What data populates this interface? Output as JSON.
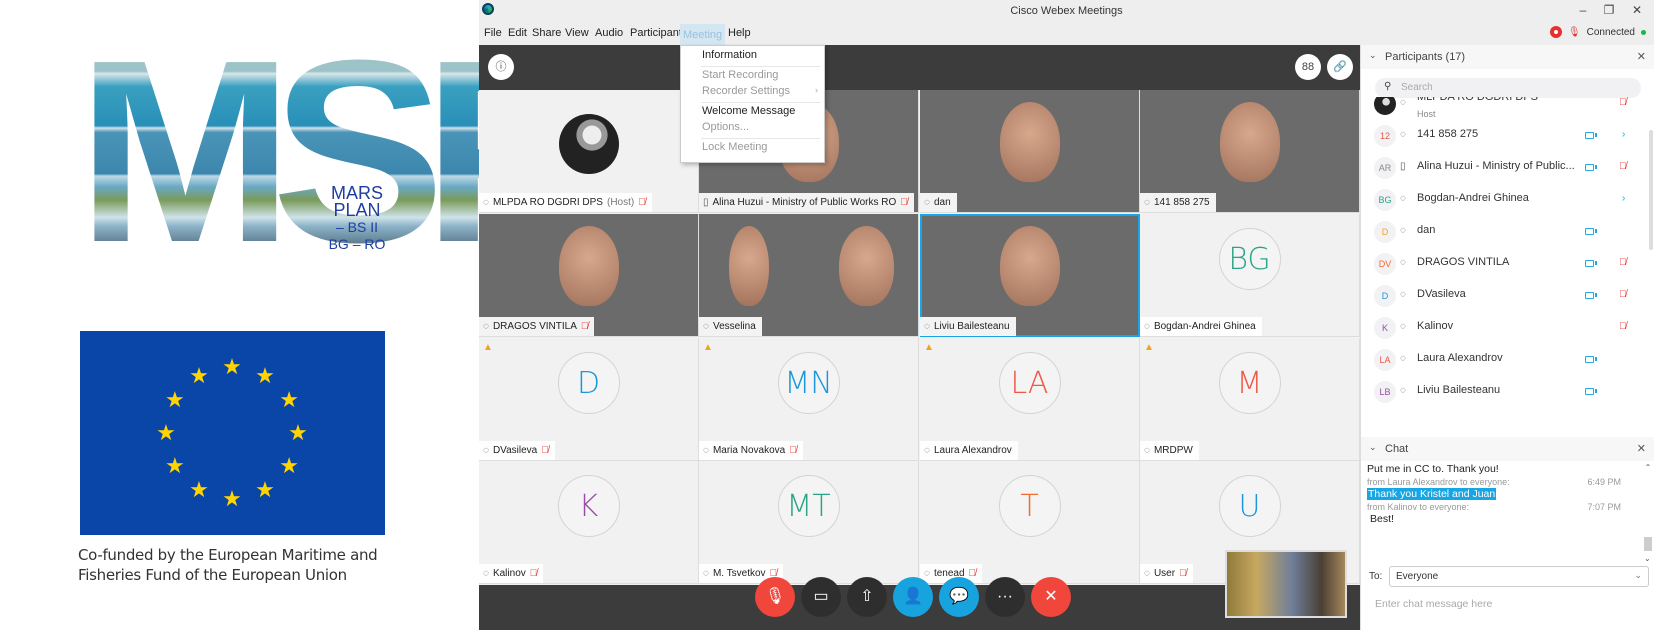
{
  "logos": {
    "msp_letters": "MSP",
    "msp_lines": [
      "MARS",
      "PLAN",
      "– BS II",
      "BG – RO"
    ],
    "eu_caption_lines": [
      "Co-funded by the European Maritime and",
      "Fisheries Fund of the European Union"
    ],
    "eu_colors": {
      "flag": "#0a46a8",
      "star": "#ffd400"
    }
  },
  "window": {
    "title": "Cisco Webex Meetings",
    "controls": {
      "minimize": "–",
      "restore": "❐",
      "close": "✕"
    },
    "menu": [
      "File",
      "Edit",
      "Share",
      "View",
      "Audio",
      "Participant",
      "Meeting",
      "Help"
    ],
    "active_menu": "Meeting",
    "status": {
      "connection": "Connected"
    }
  },
  "meeting_menu": {
    "items": [
      {
        "label": "Information",
        "enabled": true
      },
      {
        "label": "Start Recording",
        "enabled": false
      },
      {
        "label": "Recorder Settings",
        "enabled": false,
        "submenu": true
      },
      {
        "label": "Welcome Message",
        "enabled": true
      },
      {
        "label": "Options...",
        "enabled": false
      },
      {
        "label": "Lock Meeting",
        "enabled": false
      }
    ]
  },
  "header": {
    "info_icon": "ⓘ",
    "layout_icon": "88",
    "link_icon": "🔗"
  },
  "tiles": [
    {
      "name": "MLPDA RO DGDRI DPS",
      "suffix": "(Host)",
      "type": "photo",
      "muted": true,
      "device": "headset"
    },
    {
      "name": "Alina Huzui - Ministry of Public Works RO",
      "type": "video",
      "muted": true,
      "device": "phone"
    },
    {
      "name": "dan",
      "type": "video",
      "muted": false,
      "device": "headset"
    },
    {
      "name": "141 858 275",
      "type": "video",
      "muted": false,
      "device": "headset"
    },
    {
      "name": "DRAGOS VINTILA",
      "type": "video",
      "muted": true,
      "device": "headset"
    },
    {
      "name": "Vesselina",
      "type": "video",
      "muted": false,
      "device": "headset"
    },
    {
      "name": "Liviu Bailesteanu",
      "type": "video",
      "muted": false,
      "active": true,
      "device": "headset"
    },
    {
      "name": "Bogdan-Andrei Ghinea",
      "type": "initials",
      "initials": "BG",
      "color": "#2aa486",
      "muted": false
    },
    {
      "name": "DVasileva",
      "type": "initials",
      "initials": "D",
      "color": "#1b96d8",
      "muted": true,
      "warning": true
    },
    {
      "name": "Maria Novakova",
      "type": "initials",
      "initials": "MN",
      "color": "#1b96d8",
      "muted": true,
      "warning": true
    },
    {
      "name": "Laura Alexandrov",
      "type": "initials",
      "initials": "LA",
      "color": "#ef5646",
      "muted": false,
      "warning": true
    },
    {
      "name": "MRDPW",
      "type": "initials",
      "initials": "M",
      "color": "#ef5646",
      "muted": false,
      "warning": true
    },
    {
      "name": "Kalinov",
      "type": "initials",
      "initials": "K",
      "color": "#9a4aa8",
      "muted": true
    },
    {
      "name": "M. Tsvetkov",
      "type": "initials",
      "initials": "MT",
      "color": "#2aa486",
      "muted": true
    },
    {
      "name": "tenead",
      "type": "initials",
      "initials": "T",
      "color": "#f36b2c",
      "muted": true
    },
    {
      "name": "User",
      "type": "initials",
      "initials": "U",
      "color": "#1b96d8",
      "muted": true
    }
  ],
  "controls": {
    "mute": "🎙",
    "video": "▭",
    "share": "⇧",
    "participants": "👤",
    "chat": "💬",
    "more": "···",
    "leave": "✕"
  },
  "participants_panel": {
    "title": "Participants (17)",
    "search_placeholder": "Search",
    "rows": [
      {
        "initials": "",
        "name": "MLPDA RO DGDRI DPS",
        "sub": "Host",
        "video": false,
        "muted": true,
        "device": "headset"
      },
      {
        "initials": "12",
        "color": "#ef5646",
        "name": "141 858 275",
        "video": true,
        "muted": false,
        "expand": true,
        "device": "headset"
      },
      {
        "initials": "AR",
        "color": "#888888",
        "name": "Alina Huzui - Ministry of Public...",
        "video": true,
        "muted": true,
        "device": "phone"
      },
      {
        "initials": "BG",
        "color": "#2aa486",
        "name": "Bogdan-Andrei Ghinea",
        "video": false,
        "muted": false,
        "expand": true,
        "device": "headset"
      },
      {
        "initials": "D",
        "color": "#f2a321",
        "name": "dan",
        "video": true,
        "muted": false,
        "device": "headset"
      },
      {
        "initials": "DV",
        "color": "#f36b2c",
        "name": "DRAGOS VINTILA",
        "video": true,
        "muted": true,
        "device": "headset"
      },
      {
        "initials": "D",
        "color": "#1b96d8",
        "name": "DVasileva",
        "video": true,
        "muted": true,
        "device": "headset"
      },
      {
        "initials": "K",
        "color": "#9a4aa8",
        "name": "Kalinov",
        "video": false,
        "muted": true,
        "device": "headset"
      },
      {
        "initials": "LA",
        "color": "#ef5646",
        "name": "Laura Alexandrov",
        "video": true,
        "muted": false,
        "device": "headset"
      },
      {
        "initials": "LB",
        "color": "#9a4aa8",
        "name": "Liviu Bailesteanu",
        "video": true,
        "muted": false,
        "device": "headset"
      }
    ]
  },
  "chat_panel": {
    "title": "Chat",
    "messages": [
      {
        "text": "Put me in CC to. Thank you!"
      },
      {
        "meta": "from Laura Alexandrov to everyone:",
        "time": "6:49 PM"
      },
      {
        "text": "Thank you Kristel and Juan",
        "highlighted": true
      },
      {
        "meta": "from Kalinov to everyone:",
        "time": "7:07 PM"
      },
      {
        "text": "Best!"
      }
    ],
    "to_label": "To:",
    "to_value": "Everyone",
    "input_placeholder": "Enter chat message here"
  }
}
